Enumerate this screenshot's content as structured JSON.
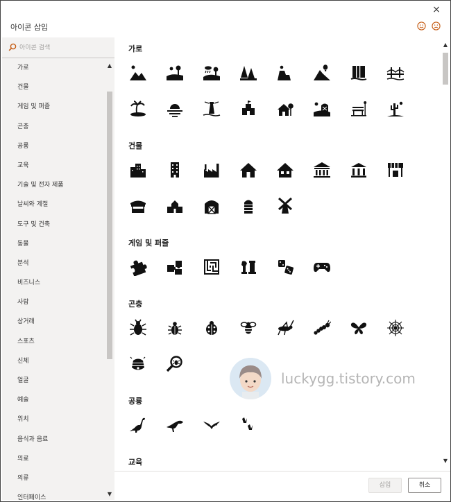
{
  "window": {
    "title": "아이콘 삽입",
    "close_glyph": "×"
  },
  "search": {
    "placeholder": "아이콘 검색"
  },
  "categories": [
    "가로",
    "건물",
    "게임 및 퍼즐",
    "곤충",
    "공룡",
    "교육",
    "기술 및 전자 제품",
    "날씨와 계절",
    "도구 및 건축",
    "동물",
    "분석",
    "비즈니스",
    "사람",
    "상거래",
    "스포츠",
    "신체",
    "얼굴",
    "예술",
    "위치",
    "음식과 음료",
    "의료",
    "의류",
    "인터페이스"
  ],
  "sections": [
    {
      "title": "가로",
      "icons": [
        "mountains-sun-icon",
        "field-sun-icon",
        "hills-rain-icon",
        "forest-icon",
        "mesa-sun-icon",
        "volcano-balloon-icon",
        "waterfall-icon",
        "bridge-icon",
        "island-palm-icon",
        "sunset-water-icon",
        "lighthouse-icon",
        "sandcastle-icon",
        "house-tree-icon",
        "barn-field-icon",
        "park-bench-icon",
        "desert-cactus-icon"
      ]
    },
    {
      "title": "건물",
      "icons": [
        "city-buildings-icon",
        "office-tower-icon",
        "factory-icon",
        "house-icon",
        "home-icon",
        "museum-icon",
        "bank-icon",
        "store-icon",
        "market-stall-icon",
        "school-icon",
        "barn-icon",
        "silo-icon",
        "windmill-icon"
      ]
    },
    {
      "title": "게임 및 퍼즐",
      "icons": [
        "puzzle-piece-icon",
        "puzzle-pieces-icon",
        "maze-icon",
        "chess-icon",
        "dice-icon",
        "game-controller-icon"
      ]
    },
    {
      "title": "곤충",
      "icons": [
        "beetle-icon",
        "bug-icon",
        "ladybug-icon",
        "bee-icon",
        "grasshopper-icon",
        "caterpillar-icon",
        "butterfly-icon",
        "spider-web-icon",
        "beehive-icon",
        "bug-magnifier-icon"
      ]
    },
    {
      "title": "공룡",
      "icons": [
        "brontosaurus-icon",
        "t-rex-icon",
        "pterodactyl-icon",
        "dinosaur-footprints-icon"
      ]
    },
    {
      "title": "교육",
      "icons": []
    }
  ],
  "buttons": {
    "insert": "삽입",
    "cancel": "취소"
  },
  "watermark": "luckygg.tistory.com",
  "colors": {
    "accent": "#c55a11",
    "icon": "#111111",
    "sidebar_bg": "#f3f2f1"
  }
}
